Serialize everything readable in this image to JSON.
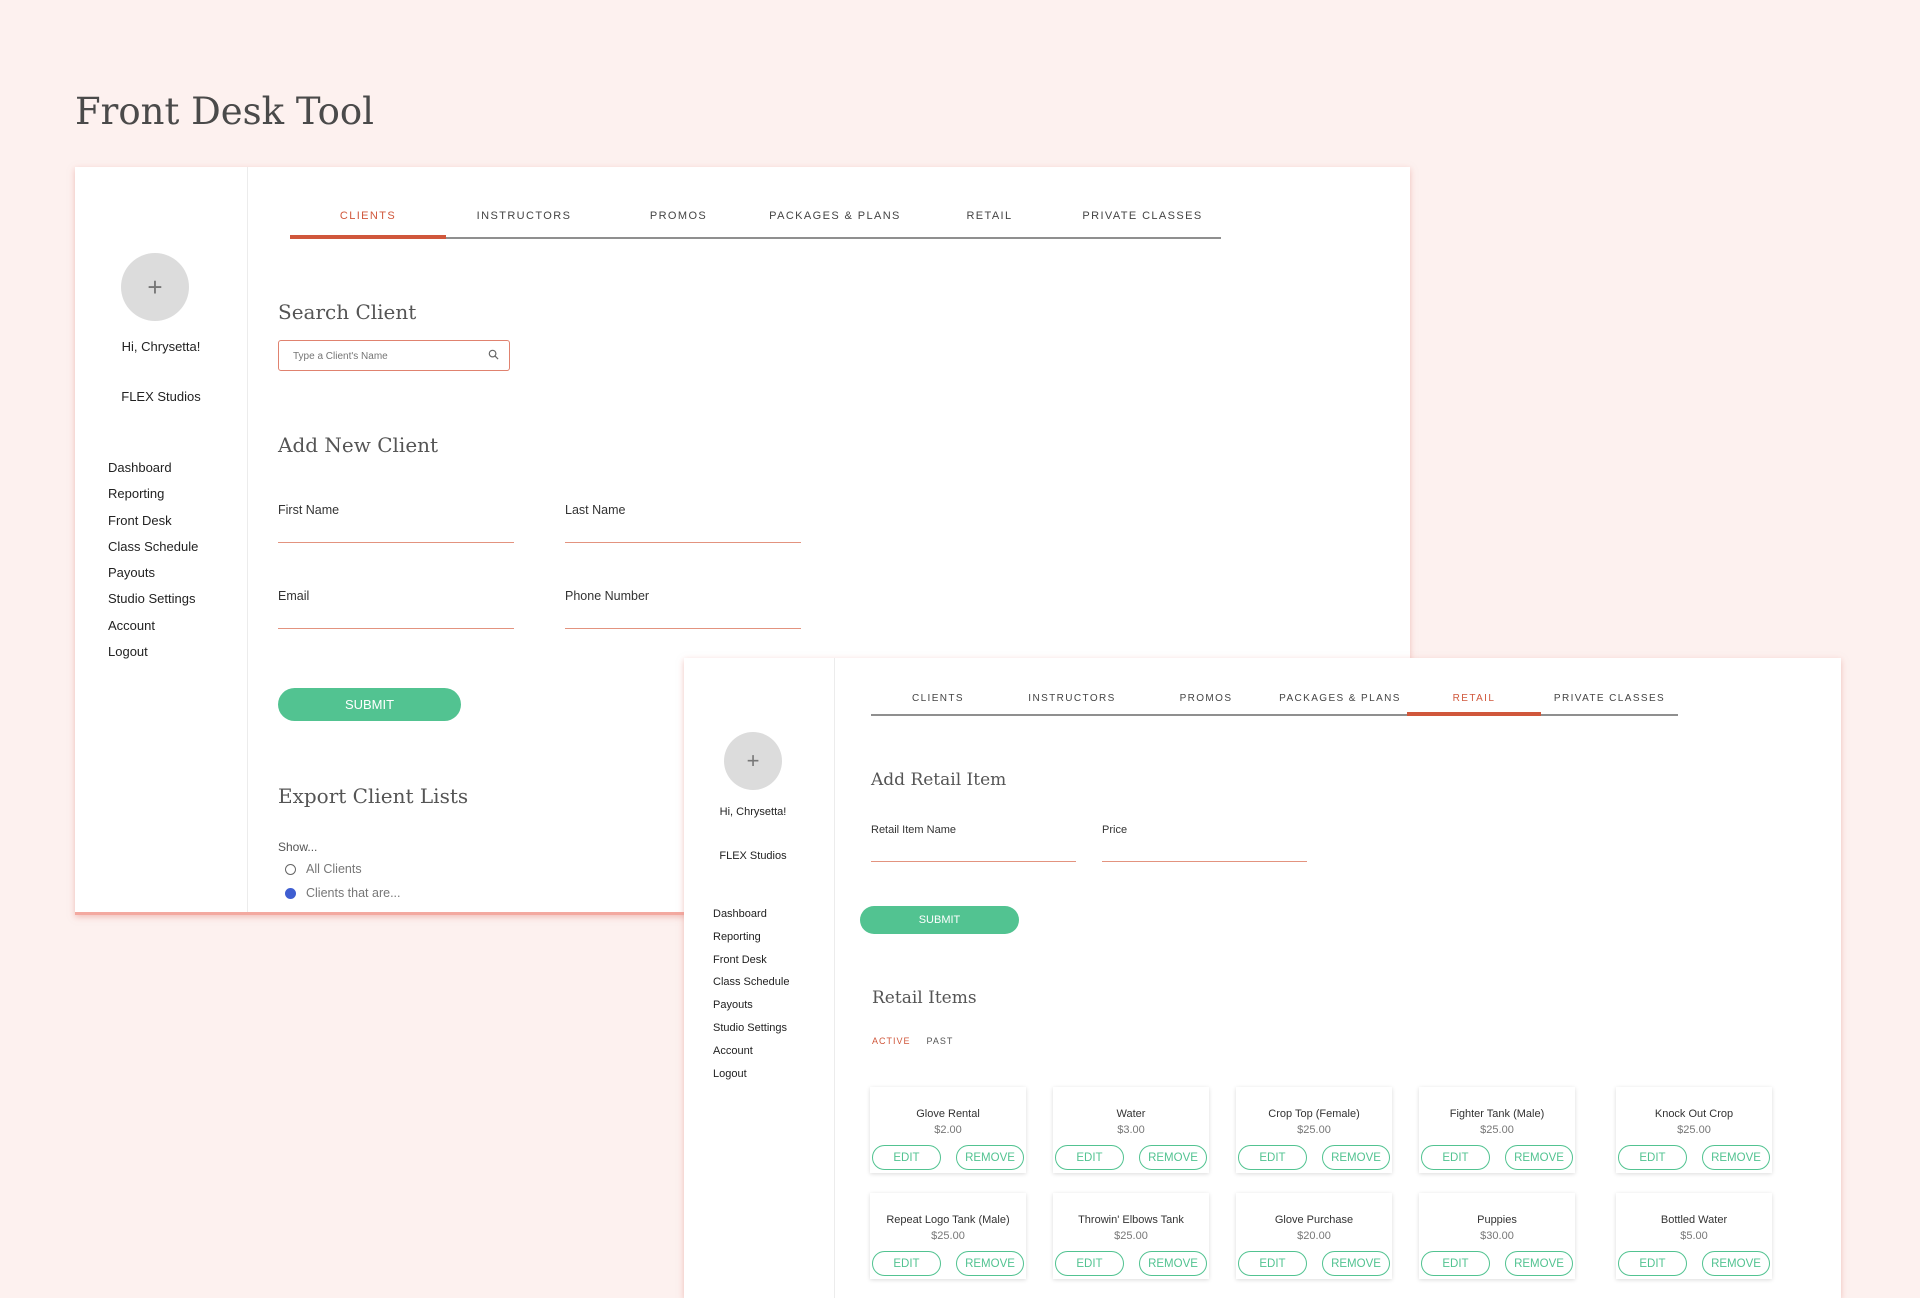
{
  "page_title": "Front Desk Tool",
  "sidebar": {
    "avatar_symbol": "+",
    "greeting": "Hi, Chrysetta!",
    "studio": "FLEX Studios",
    "nav": [
      "Dashboard",
      "Reporting",
      "Front Desk",
      "Class Schedule",
      "Payouts",
      "Studio Settings",
      "Account",
      "Logout"
    ]
  },
  "tabs": [
    "CLIENTS",
    "INSTRUCTORS",
    "PROMOS",
    "PACKAGES & PLANS",
    "RETAIL",
    "PRIVATE CLASSES"
  ],
  "clients_screen": {
    "active_tab": "CLIENTS",
    "search": {
      "title": "Search Client",
      "placeholder": "Type a Client's Name",
      "value": ""
    },
    "add_client": {
      "title": "Add New Client",
      "first_name_label": "First Name",
      "last_name_label": "Last Name",
      "email_label": "Email",
      "phone_label": "Phone Number",
      "submit_label": "SUBMIT"
    },
    "export": {
      "title": "Export Client Lists",
      "show_label": "Show...",
      "options": [
        {
          "label": "All Clients",
          "selected": false
        },
        {
          "label": "Clients that are...",
          "selected": true
        }
      ]
    }
  },
  "retail_screen": {
    "active_tab": "RETAIL",
    "add_item": {
      "title": "Add Retail Item",
      "name_label": "Retail Item Name",
      "price_label": "Price",
      "submit_label": "SUBMIT"
    },
    "items_title": "Retail Items",
    "sub_tabs": [
      {
        "label": "ACTIVE",
        "active": true
      },
      {
        "label": "PAST",
        "active": false
      }
    ],
    "edit_label": "EDIT",
    "remove_label": "REMOVE",
    "items": [
      {
        "name": "Glove Rental",
        "price": "$2.00"
      },
      {
        "name": "Water",
        "price": "$3.00"
      },
      {
        "name": "Crop Top (Female)",
        "price": "$25.00"
      },
      {
        "name": "Fighter Tank (Male)",
        "price": "$25.00"
      },
      {
        "name": "Knock Out Crop",
        "price": "$25.00"
      },
      {
        "name": "Repeat Logo Tank (Male)",
        "price": "$25.00"
      },
      {
        "name": "Throwin' Elbows Tank",
        "price": "$25.00"
      },
      {
        "name": "Glove Purchase",
        "price": "$20.00"
      },
      {
        "name": "Puppies",
        "price": "$30.00"
      },
      {
        "name": "Bottled Water",
        "price": "$5.00"
      }
    ]
  },
  "colors": {
    "accent": "#d0573b",
    "button_green": "#52c391",
    "background": "#fdf1ef",
    "radio_selected": "#3f5ed1"
  }
}
